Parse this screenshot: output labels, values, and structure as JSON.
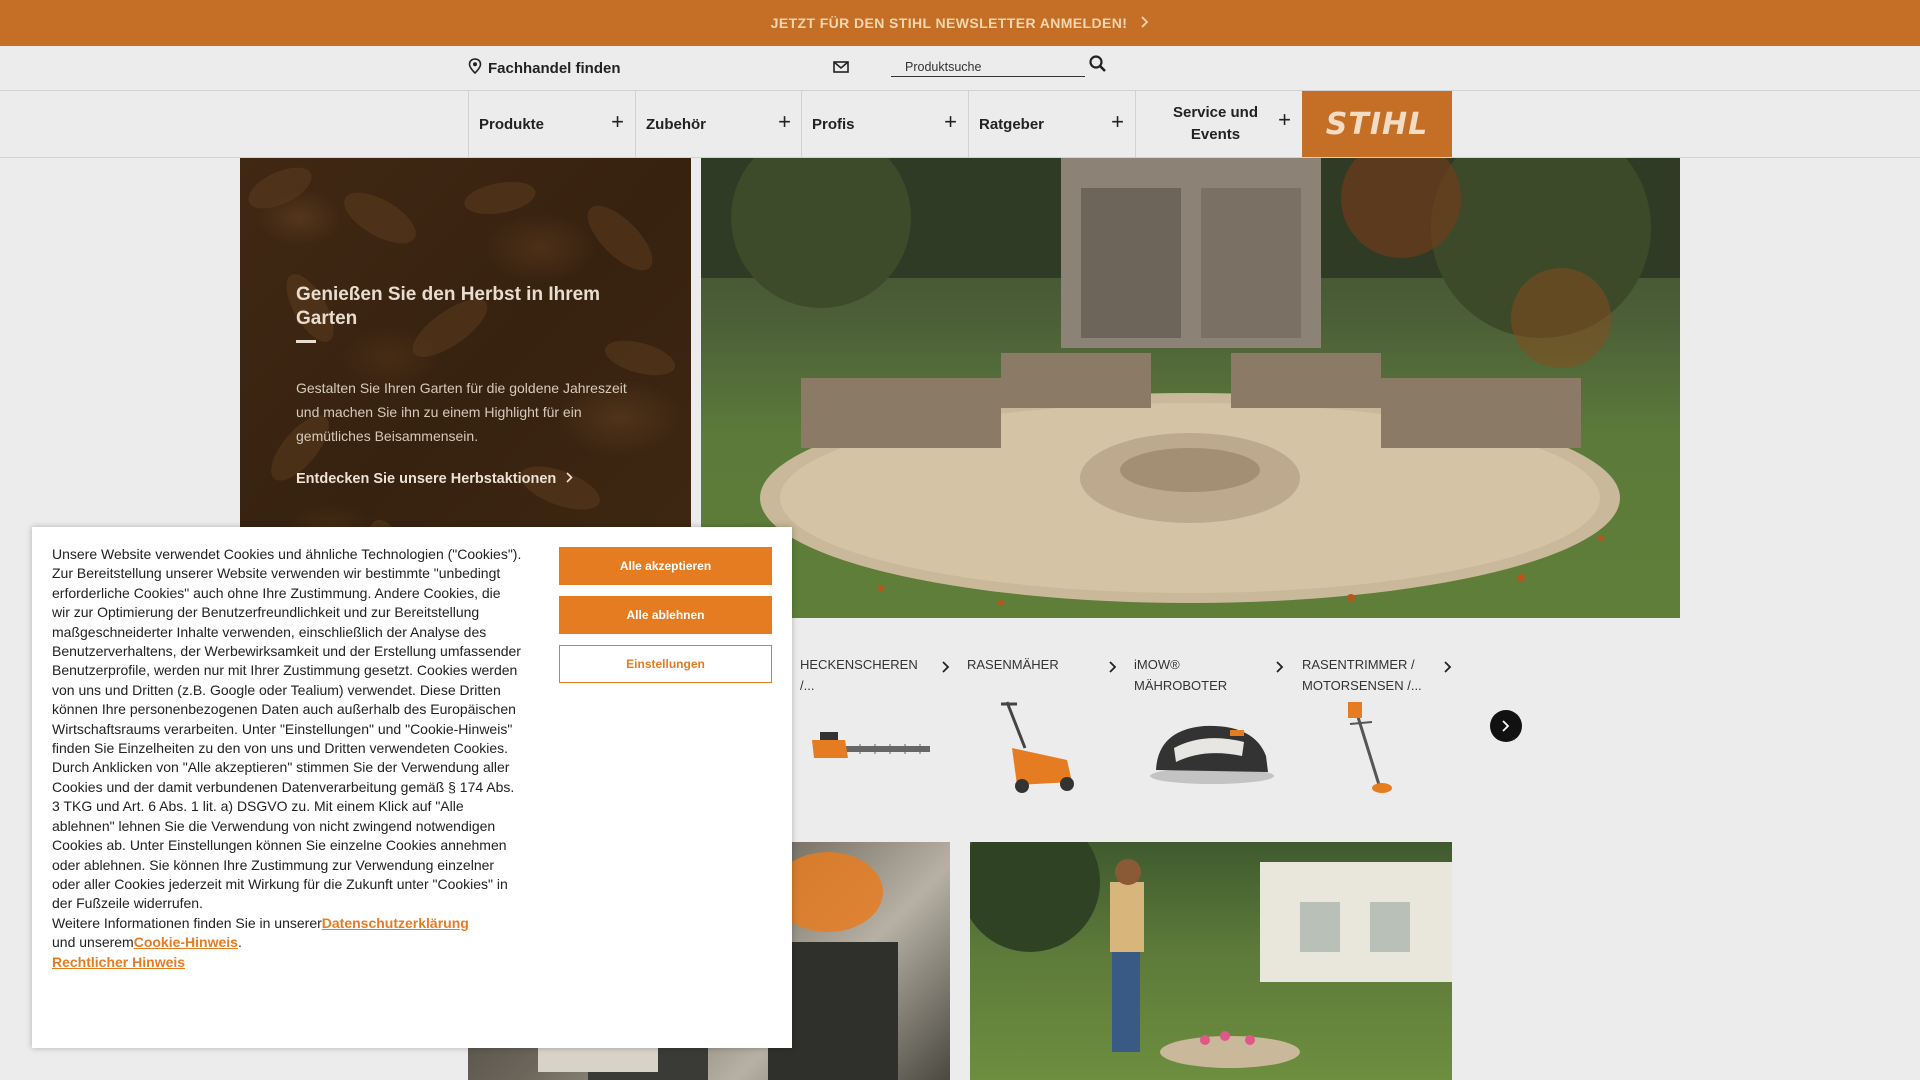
{
  "banner": {
    "text": "JETZT FÜR DEN STIHL NEWSLETTER ANMELDEN!"
  },
  "utility": {
    "dealer_label": "Fachhandel finden",
    "search_placeholder": "Produktsuche"
  },
  "nav": {
    "items": [
      {
        "label": "Produkte"
      },
      {
        "label": "Zubehör"
      },
      {
        "label": "Profis"
      },
      {
        "label": "Ratgeber"
      },
      {
        "label": "Service und Events"
      }
    ],
    "logo": "STIHL"
  },
  "hero": {
    "title": "Genießen Sie den Herbst in Ihrem Garten",
    "body": "Gestalten Sie Ihren Garten für die goldene Jahreszeit und machen Sie ihn zu einem Highlight für ein gemütliches Beisammensein.",
    "link": "Entdecken Sie unsere Herbstaktionen"
  },
  "categories": [
    {
      "label": "HECKENSCHEREN /..."
    },
    {
      "label": "RASENMÄHER"
    },
    {
      "label": "iMOW® MÄHROBOTER"
    },
    {
      "label": "RASENTRIMMER / MOTORSENSEN /..."
    }
  ],
  "cookie": {
    "text": "Unsere Website verwendet Cookies und ähnliche Technologien (\"Cookies\"). Zur Bereitstellung unserer Website verwenden wir bestimmte \"unbedingt erforderliche Cookies\" auch ohne Ihre Zustimmung. Andere Cookies, die wir zur Optimierung der Benutzerfreundlichkeit und zur Bereitstellung maßgeschneiderter Inhalte verwenden, einschließlich der Analyse des Benutzerverhaltens, der Werbewirksamkeit und der Erstellung umfassender Benutzerprofile, werden nur mit Ihrer Zustimmung gesetzt. Cookies werden von uns und Dritten (z.B. Google oder Tealium) verwendet. Diese Dritten können Ihre personenbezogenen Daten auch außerhalb des Europäischen Wirtschaftsraums verarbeiten. Unter \"Einstellungen\" und \"Cookie-Hinweis\" finden Sie Einzelheiten zu den von uns und Dritten verwendeten Cookies. Durch Anklicken von \"Alle akzeptieren\" stimmen Sie der Verwendung aller Cookies und der damit verbundenen Datenverarbeitung gemäß § 174 Abs. 3 TKG und Art. 6 Abs. 1 lit. a) DSGVO zu. Mit einem Klick auf \"Alle ablehnen\" lehnen Sie die Verwendung von nicht zwingend notwendigen Cookies ab. Unter Einstellungen können Sie einzelne Cookies annehmen oder ablehnen. Sie können Ihre Zustimmung zur Verwendung einzelner oder aller Cookies jederzeit mit Wirkung für die Zukunft unter \"Cookies\" in der Fußzeile widerrufen.",
    "more_prefix": "Weitere Informationen finden Sie in unserer",
    "privacy_link": "Datenschutzerklärung",
    "and_prefix": "und unserem",
    "cookie_link": "Cookie-Hinweis",
    "period": ".",
    "legal_link": "Rechtlicher Hinweis",
    "accept_all": "Alle akzeptieren",
    "reject_all": "Alle ablehnen",
    "settings": "Einstellungen"
  },
  "colors": {
    "brand": "#c56f26",
    "accent": "#e67c22"
  }
}
